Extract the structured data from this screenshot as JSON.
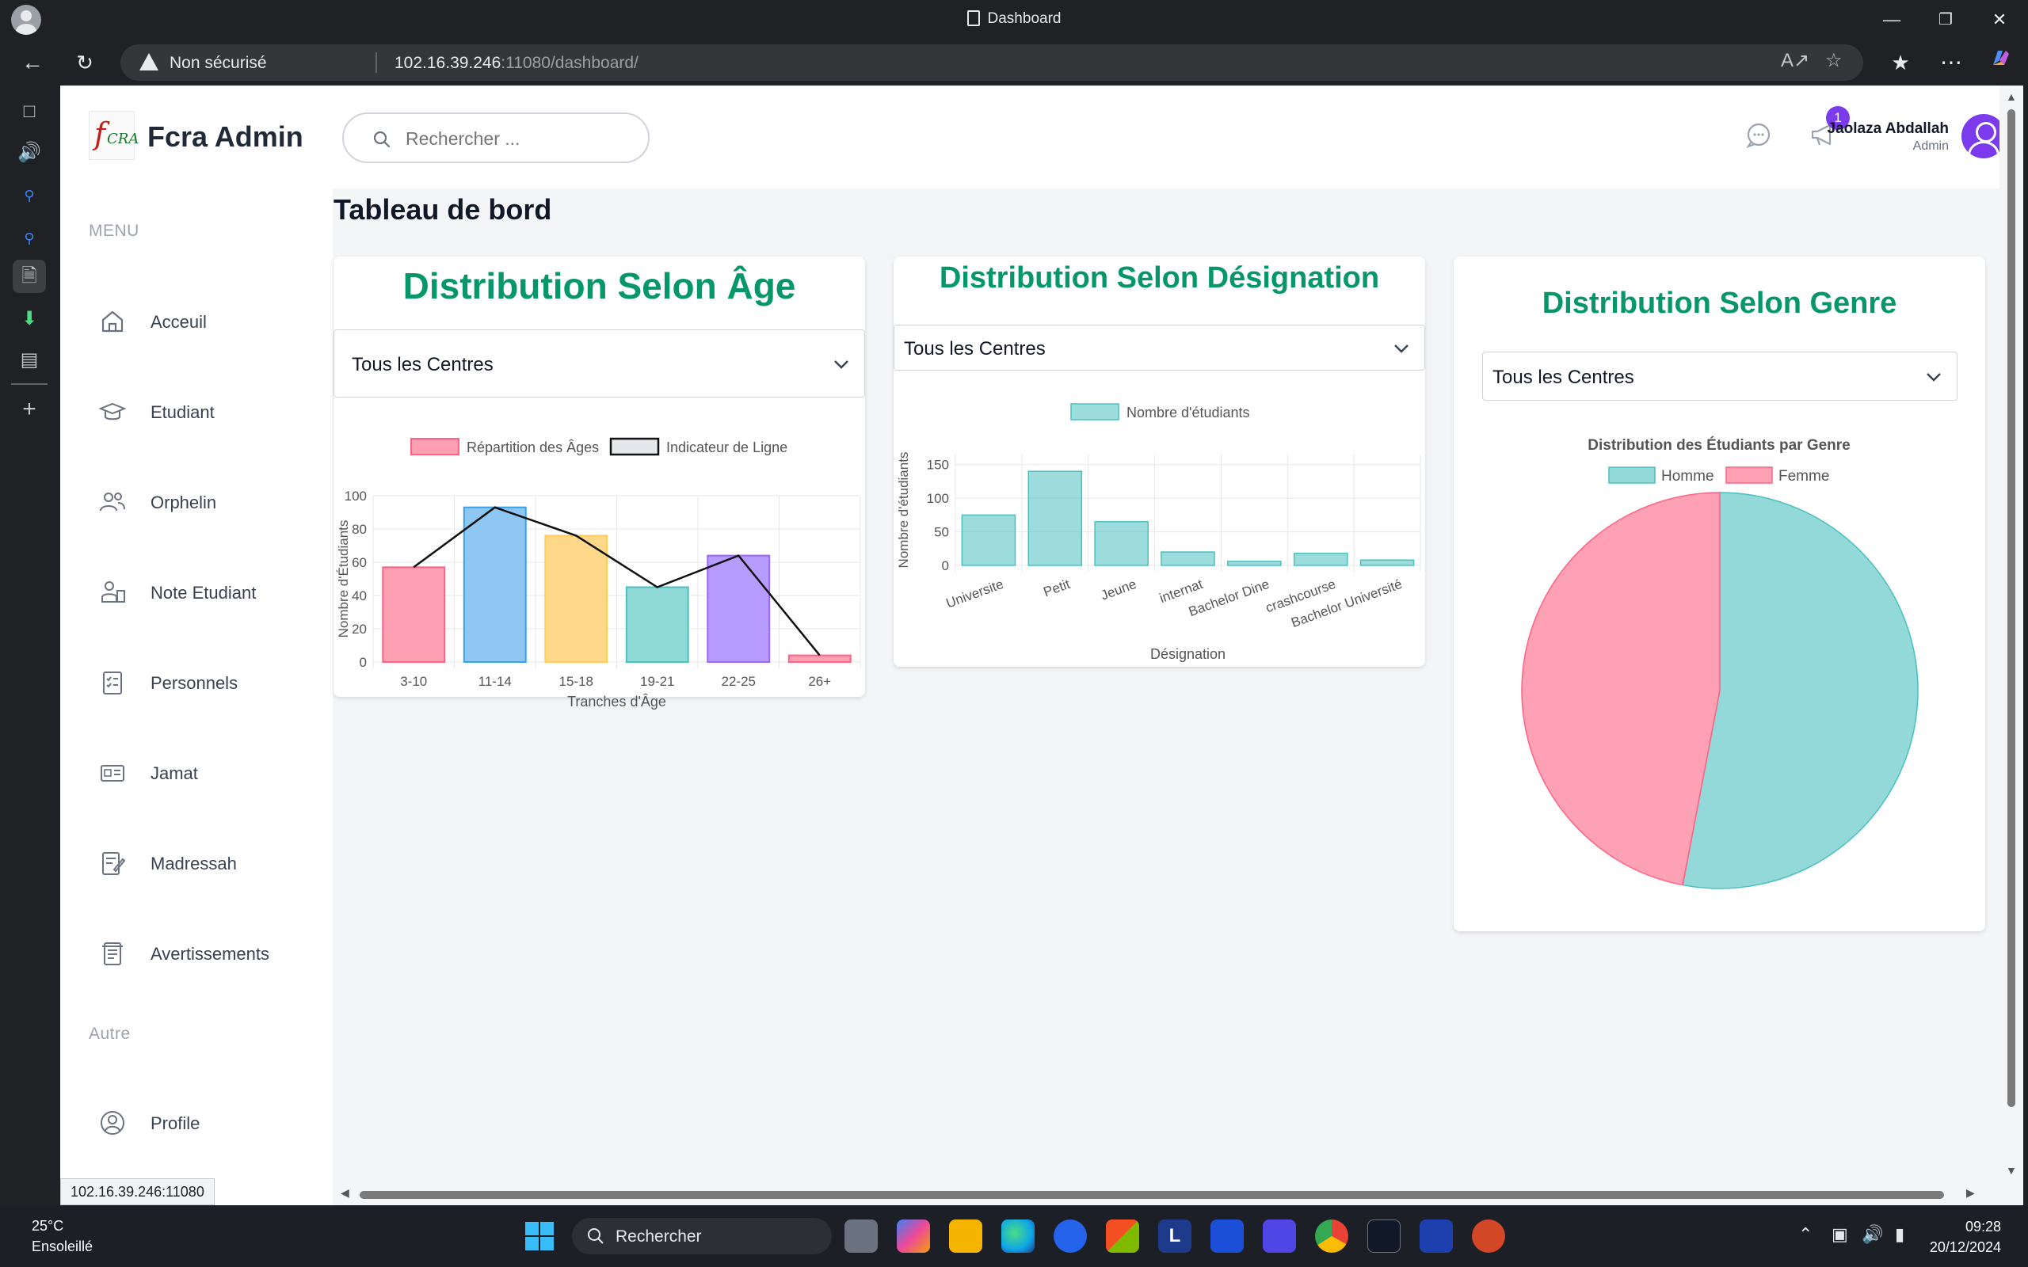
{
  "browser": {
    "tab_title": "Dashboard",
    "security_label": "Non sécurisé",
    "url_host": "102.16.39.246",
    "url_rest": ":11080/dashboard/",
    "status_url": "102.16.39.246:11080"
  },
  "brand": {
    "name": "Fcra Admin",
    "logo_f": "f",
    "logo_cra": "CRA"
  },
  "search": {
    "placeholder": "Rechercher ..."
  },
  "user": {
    "name": "Jaolaza Abdallah",
    "role": "Admin",
    "notifications": "1"
  },
  "menu": {
    "heading": "MENU",
    "items": [
      {
        "label": "Acceuil",
        "icon": "home-icon"
      },
      {
        "label": "Etudiant",
        "icon": "graduation-cap-icon"
      },
      {
        "label": "Orphelin",
        "icon": "users-icon"
      },
      {
        "label": "Note Etudiant",
        "icon": "user-notes-icon"
      },
      {
        "label": "Personnels",
        "icon": "clipboard-list-icon"
      },
      {
        "label": "Jamat",
        "icon": "id-card-icon"
      },
      {
        "label": "Madressah",
        "icon": "edit-note-icon"
      },
      {
        "label": "Avertissements",
        "icon": "warning-doc-icon"
      }
    ],
    "other_heading": "Autre",
    "other_items": [
      {
        "label": "Profile",
        "icon": "user-circle-icon"
      }
    ]
  },
  "page_title": "Tableau de bord",
  "cards": {
    "age": {
      "title": "Distribution Selon Âge",
      "select_value": "Tous les Centres"
    },
    "designation": {
      "title": "Distribution Selon Désignation",
      "select_value": "Tous les Centres"
    },
    "genre": {
      "title": "Distribution Selon Genre",
      "select_value": "Tous les Centres"
    }
  },
  "chart_data": [
    {
      "type": "bar",
      "title": "",
      "categories": [
        "3-10",
        "11-14",
        "15-18",
        "19-21",
        "22-25",
        "26+"
      ],
      "series": [
        {
          "name": "Répartition des Âges",
          "type": "bar",
          "values": [
            57,
            93,
            76,
            45,
            64,
            4
          ]
        },
        {
          "name": "Indicateur de Ligne",
          "type": "line",
          "values": [
            57,
            93,
            76,
            45,
            64,
            4
          ]
        }
      ],
      "bar_colors": [
        "#ff9fb3",
        "#8ec7f1",
        "#ffd88a",
        "#8fd9d6",
        "#b79bff",
        "#ff9fb3"
      ],
      "bar_borders": [
        "#ff6384",
        "#36a2eb",
        "#ffce56",
        "#4bc0c0",
        "#9966ff",
        "#ff6384"
      ],
      "xlabel": "Tranches d'Âge",
      "ylabel": "Nombre d'Étudiants",
      "ylim": [
        0,
        100
      ],
      "yticks": [
        0,
        20,
        40,
        60,
        80,
        100
      ],
      "grid": true,
      "legend": "top"
    },
    {
      "type": "bar",
      "title": "",
      "categories": [
        "Universite",
        "Petit",
        "Jeune",
        "internat",
        "Bachelor Dine",
        "crashcourse",
        "Bachelor Université"
      ],
      "series": [
        {
          "name": "Nombre d'étudiants",
          "values": [
            75,
            140,
            65,
            20,
            6,
            18,
            8
          ]
        }
      ],
      "color": "#4bc0c0",
      "xlabel": "Désignation",
      "ylabel": "Nombre d'étudiants",
      "ylim": [
        0,
        165
      ],
      "yticks": [
        0,
        50,
        100,
        150
      ],
      "grid": true,
      "legend": "top"
    },
    {
      "type": "pie",
      "title": "Distribution des Étudiants par Genre",
      "categories": [
        "Homme",
        "Femme"
      ],
      "values": [
        53,
        47
      ],
      "colors": [
        "#4bc0c0",
        "#ff6384"
      ],
      "legend": "top"
    }
  ],
  "taskbar": {
    "temperature": "25°C",
    "weather": "Ensoleillé",
    "search_label": "Rechercher",
    "time": "09:28",
    "date": "20/12/2024"
  }
}
